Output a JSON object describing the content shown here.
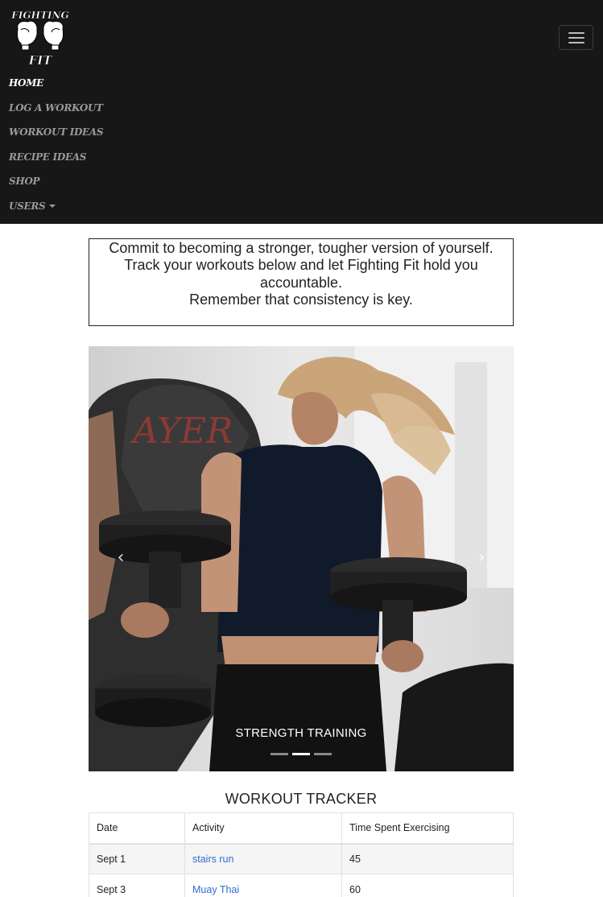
{
  "navbar": {
    "brand": {
      "logo_text_top": "FIGHTING",
      "logo_text_bottom": "FIT",
      "icon": "boxing-gloves-icon"
    },
    "toggler_icon": "hamburger-menu-icon",
    "items": [
      {
        "label": "HOME",
        "active": true
      },
      {
        "label": "LOG A WORKOUT",
        "active": false
      },
      {
        "label": "WORKOUT IDEAS",
        "active": false
      },
      {
        "label": "RECIPE IDEAS",
        "active": false
      },
      {
        "label": "SHOP",
        "active": false
      },
      {
        "label": "USERS",
        "active": false,
        "dropdown": true
      }
    ]
  },
  "intro": {
    "line1": "Commit to becoming a stronger, tougher version of yourself.",
    "line2": "Track your workouts below and let Fighting Fit hold you accountable.",
    "line3": "Remember that consistency is key."
  },
  "carousel": {
    "caption": "STRENGTH TRAINING",
    "prev_icon": "chevron-left-icon",
    "next_icon": "chevron-right-icon",
    "prev_glyph": "‹",
    "next_glyph": "›",
    "slides_count": 3,
    "active_index": 1
  },
  "tracker": {
    "title": "WORKOUT TRACKER",
    "columns": [
      "Date",
      "Activity",
      "Time Spent Exercising"
    ],
    "rows": [
      {
        "date": "Sept 1",
        "activity": "stairs run",
        "time": "45"
      },
      {
        "date": "Sept 3",
        "activity": "Muay Thai",
        "time": "60"
      }
    ],
    "link_color": "#2f6fd0"
  },
  "colors": {
    "navbar_bg": "#171717",
    "nav_active": "#ffffff",
    "nav_inactive": "#9a9a9a"
  }
}
